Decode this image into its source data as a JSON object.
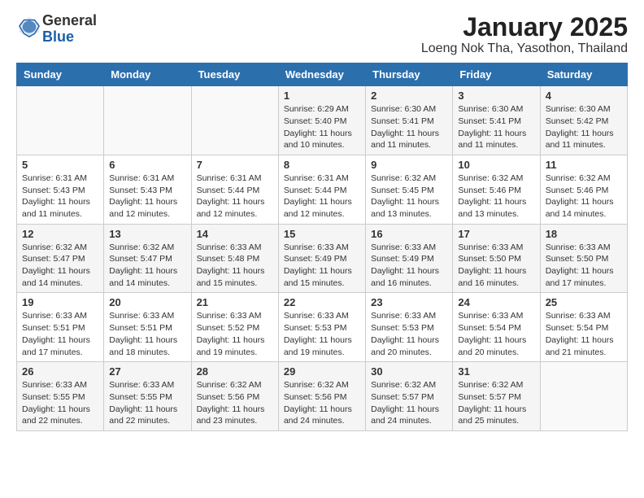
{
  "header": {
    "logo": {
      "line1": "General",
      "line2": "Blue"
    },
    "title": "January 2025",
    "subtitle": "Loeng Nok Tha, Yasothon, Thailand"
  },
  "weekdays": [
    "Sunday",
    "Monday",
    "Tuesday",
    "Wednesday",
    "Thursday",
    "Friday",
    "Saturday"
  ],
  "weeks": [
    [
      {
        "day": "",
        "info": ""
      },
      {
        "day": "",
        "info": ""
      },
      {
        "day": "",
        "info": ""
      },
      {
        "day": "1",
        "info": "Sunrise: 6:29 AM\nSunset: 5:40 PM\nDaylight: 11 hours\nand 10 minutes."
      },
      {
        "day": "2",
        "info": "Sunrise: 6:30 AM\nSunset: 5:41 PM\nDaylight: 11 hours\nand 11 minutes."
      },
      {
        "day": "3",
        "info": "Sunrise: 6:30 AM\nSunset: 5:41 PM\nDaylight: 11 hours\nand 11 minutes."
      },
      {
        "day": "4",
        "info": "Sunrise: 6:30 AM\nSunset: 5:42 PM\nDaylight: 11 hours\nand 11 minutes."
      }
    ],
    [
      {
        "day": "5",
        "info": "Sunrise: 6:31 AM\nSunset: 5:43 PM\nDaylight: 11 hours\nand 11 minutes."
      },
      {
        "day": "6",
        "info": "Sunrise: 6:31 AM\nSunset: 5:43 PM\nDaylight: 11 hours\nand 12 minutes."
      },
      {
        "day": "7",
        "info": "Sunrise: 6:31 AM\nSunset: 5:44 PM\nDaylight: 11 hours\nand 12 minutes."
      },
      {
        "day": "8",
        "info": "Sunrise: 6:31 AM\nSunset: 5:44 PM\nDaylight: 11 hours\nand 12 minutes."
      },
      {
        "day": "9",
        "info": "Sunrise: 6:32 AM\nSunset: 5:45 PM\nDaylight: 11 hours\nand 13 minutes."
      },
      {
        "day": "10",
        "info": "Sunrise: 6:32 AM\nSunset: 5:46 PM\nDaylight: 11 hours\nand 13 minutes."
      },
      {
        "day": "11",
        "info": "Sunrise: 6:32 AM\nSunset: 5:46 PM\nDaylight: 11 hours\nand 14 minutes."
      }
    ],
    [
      {
        "day": "12",
        "info": "Sunrise: 6:32 AM\nSunset: 5:47 PM\nDaylight: 11 hours\nand 14 minutes."
      },
      {
        "day": "13",
        "info": "Sunrise: 6:32 AM\nSunset: 5:47 PM\nDaylight: 11 hours\nand 14 minutes."
      },
      {
        "day": "14",
        "info": "Sunrise: 6:33 AM\nSunset: 5:48 PM\nDaylight: 11 hours\nand 15 minutes."
      },
      {
        "day": "15",
        "info": "Sunrise: 6:33 AM\nSunset: 5:49 PM\nDaylight: 11 hours\nand 15 minutes."
      },
      {
        "day": "16",
        "info": "Sunrise: 6:33 AM\nSunset: 5:49 PM\nDaylight: 11 hours\nand 16 minutes."
      },
      {
        "day": "17",
        "info": "Sunrise: 6:33 AM\nSunset: 5:50 PM\nDaylight: 11 hours\nand 16 minutes."
      },
      {
        "day": "18",
        "info": "Sunrise: 6:33 AM\nSunset: 5:50 PM\nDaylight: 11 hours\nand 17 minutes."
      }
    ],
    [
      {
        "day": "19",
        "info": "Sunrise: 6:33 AM\nSunset: 5:51 PM\nDaylight: 11 hours\nand 17 minutes."
      },
      {
        "day": "20",
        "info": "Sunrise: 6:33 AM\nSunset: 5:51 PM\nDaylight: 11 hours\nand 18 minutes."
      },
      {
        "day": "21",
        "info": "Sunrise: 6:33 AM\nSunset: 5:52 PM\nDaylight: 11 hours\nand 19 minutes."
      },
      {
        "day": "22",
        "info": "Sunrise: 6:33 AM\nSunset: 5:53 PM\nDaylight: 11 hours\nand 19 minutes."
      },
      {
        "day": "23",
        "info": "Sunrise: 6:33 AM\nSunset: 5:53 PM\nDaylight: 11 hours\nand 20 minutes."
      },
      {
        "day": "24",
        "info": "Sunrise: 6:33 AM\nSunset: 5:54 PM\nDaylight: 11 hours\nand 20 minutes."
      },
      {
        "day": "25",
        "info": "Sunrise: 6:33 AM\nSunset: 5:54 PM\nDaylight: 11 hours\nand 21 minutes."
      }
    ],
    [
      {
        "day": "26",
        "info": "Sunrise: 6:33 AM\nSunset: 5:55 PM\nDaylight: 11 hours\nand 22 minutes."
      },
      {
        "day": "27",
        "info": "Sunrise: 6:33 AM\nSunset: 5:55 PM\nDaylight: 11 hours\nand 22 minutes."
      },
      {
        "day": "28",
        "info": "Sunrise: 6:32 AM\nSunset: 5:56 PM\nDaylight: 11 hours\nand 23 minutes."
      },
      {
        "day": "29",
        "info": "Sunrise: 6:32 AM\nSunset: 5:56 PM\nDaylight: 11 hours\nand 24 minutes."
      },
      {
        "day": "30",
        "info": "Sunrise: 6:32 AM\nSunset: 5:57 PM\nDaylight: 11 hours\nand 24 minutes."
      },
      {
        "day": "31",
        "info": "Sunrise: 6:32 AM\nSunset: 5:57 PM\nDaylight: 11 hours\nand 25 minutes."
      },
      {
        "day": "",
        "info": ""
      }
    ]
  ]
}
